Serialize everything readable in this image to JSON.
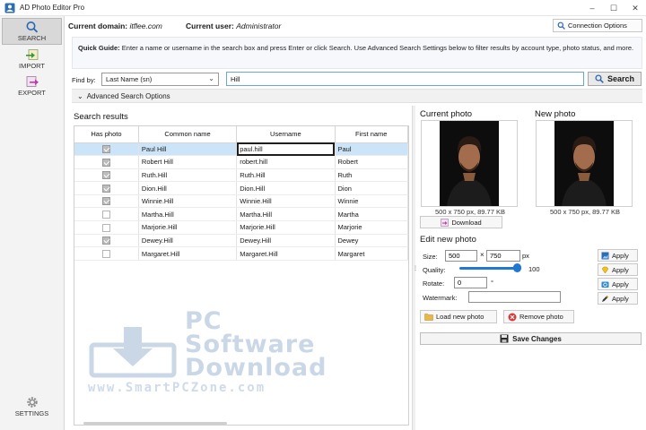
{
  "window": {
    "title": "AD Photo Editor Pro",
    "minimize": "–",
    "maximize": "☐",
    "close": "✕"
  },
  "nav": {
    "search": "SEARCH",
    "import": "IMPORT",
    "export": "EXPORT",
    "settings": "SETTINGS"
  },
  "header": {
    "domain_label": "Current domain:",
    "domain_value": "itflee.com",
    "user_label": "Current user:",
    "user_value": "Administrator",
    "connection_button": "Connection Options"
  },
  "quick_guide": {
    "label": "Quick Guide:",
    "text": "Enter a name or username in the search box and press Enter or click Search. Use Advanced Search Settings below to filter results by account type, photo status, and more."
  },
  "find": {
    "label": "Find by:",
    "selected": "Last Name (sn)",
    "query": "Hill",
    "search_button": "Search"
  },
  "advanced": {
    "label": "Advanced Search Options"
  },
  "results": {
    "title": "Search results",
    "columns": [
      "Has photo",
      "Common name",
      "Username",
      "First name"
    ],
    "rows": [
      {
        "has_photo": true,
        "common_name": "Paul Hill",
        "username": "paul.hill",
        "first_name": "Paul"
      },
      {
        "has_photo": true,
        "common_name": "Robert Hill",
        "username": "robert.hill",
        "first_name": "Robert"
      },
      {
        "has_photo": true,
        "common_name": "Ruth.Hill",
        "username": "Ruth.Hill",
        "first_name": "Ruth"
      },
      {
        "has_photo": true,
        "common_name": "Dion.Hill",
        "username": "Dion.Hill",
        "first_name": "Dion"
      },
      {
        "has_photo": true,
        "common_name": "Winnie.Hill",
        "username": "Winnie.Hill",
        "first_name": "Winnie"
      },
      {
        "has_photo": false,
        "common_name": "Martha.Hill",
        "username": "Martha.Hill",
        "first_name": "Martha"
      },
      {
        "has_photo": false,
        "common_name": "Marjorie.Hill",
        "username": "Marjorie.Hill",
        "first_name": "Marjorie"
      },
      {
        "has_photo": true,
        "common_name": "Dewey.Hill",
        "username": "Dewey.Hill",
        "first_name": "Dewey"
      },
      {
        "has_photo": false,
        "common_name": "Margaret.Hill",
        "username": "Margaret.Hill",
        "first_name": "Margaret"
      }
    ],
    "selected_index": 0
  },
  "watermark": {
    "line1": "PC",
    "line2": "Software",
    "line3": "Download",
    "url": "www.SmartPCZone.com"
  },
  "photos": {
    "current_label": "Current photo",
    "new_label": "New photo",
    "current_info": "500 x 750 px, 89.77 KB",
    "new_info": "500 x 750 px, 89.77 KB",
    "download_button": "Download"
  },
  "edit": {
    "title": "Edit new photo",
    "size_label": "Size:",
    "width": "500",
    "times": "×",
    "height": "750",
    "unit": "px",
    "quality_label": "Quality:",
    "quality_value": "100",
    "quality_fraction": 1.0,
    "rotate_label": "Rotate:",
    "rotate_value": "0",
    "degree": "°",
    "watermark_label": "Watermark:",
    "watermark_value": "",
    "apply": "Apply",
    "load_button": "Load new photo",
    "remove_button": "Remove photo",
    "save_button": "Save Changes"
  },
  "colors": {
    "accent": "#1f78d1",
    "selection": "#cce4f7",
    "watermark": "#9fb8d4"
  }
}
